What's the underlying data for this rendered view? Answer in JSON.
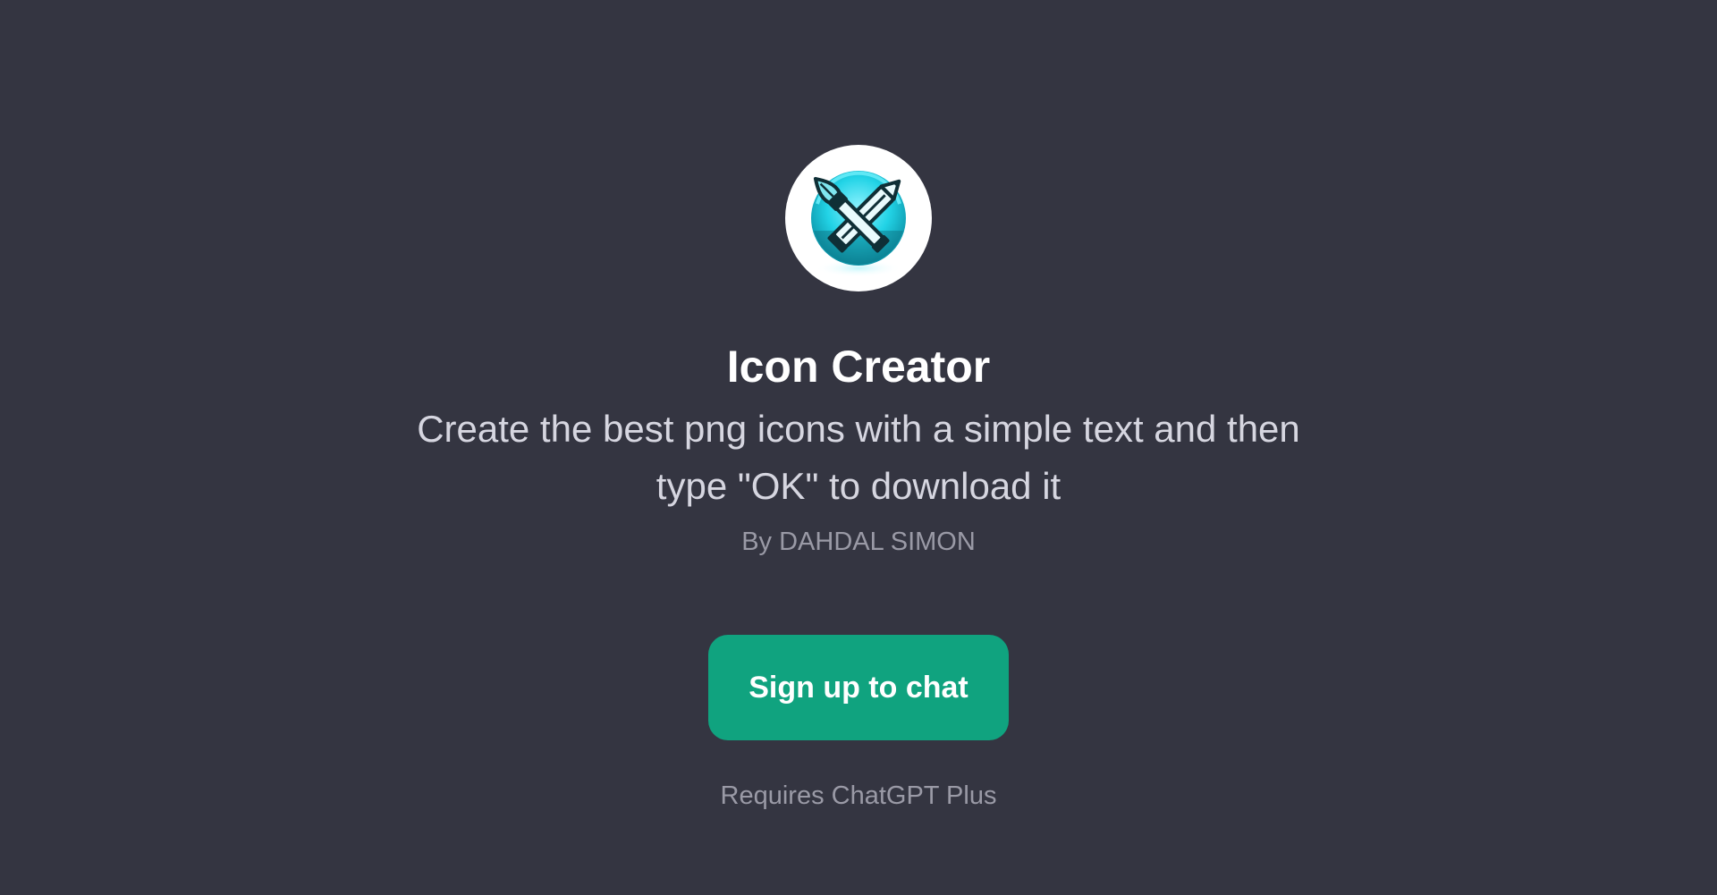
{
  "gpt": {
    "avatar_icon": "crossed-paintbrush-pencil-icon",
    "name": "Icon Creator",
    "description": "Create the best png icons with a simple text and then type \"OK\" to download it",
    "author": "By DAHDAL SIMON"
  },
  "cta": {
    "label": "Sign up to chat"
  },
  "requirement": "Requires ChatGPT Plus",
  "colors": {
    "background": "#343541",
    "accent": "#10a37f",
    "title": "#ffffff",
    "description": "#d6d6e0",
    "muted": "#9a9aa6",
    "icon_cyan": "#22d3e6"
  }
}
